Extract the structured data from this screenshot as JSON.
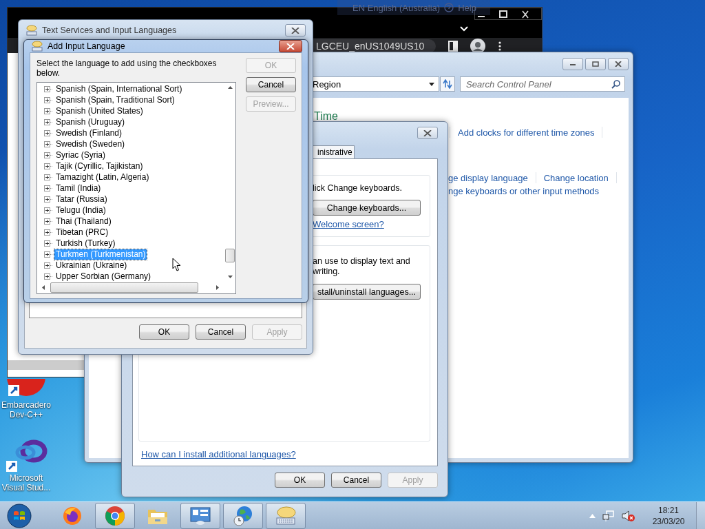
{
  "language_bar": {
    "language": "EN English (Australia)",
    "help": "Help"
  },
  "browser": {
    "address": "LGCEU_enUS1049US10"
  },
  "control_panel": {
    "address": "Region",
    "search_placeholder": "Search Control Panel",
    "heading": "Time",
    "top_link": "Add clocks for different time zones",
    "links_row": [
      "ge display language",
      "Change location"
    ],
    "link_below": "nge keyboards or other input methods"
  },
  "region_dialog": {
    "tab": "inistrative",
    "keyboards_text": "lick Change keyboards.",
    "keyboards_button": "Change keyboards...",
    "welcome_link": "Welcome screen?",
    "display_text": "an use to display text and writing.",
    "install_button": "stall/uninstall languages...",
    "help_link": "How can I install additional languages?",
    "buttons": [
      {
        "label": "OK",
        "disabled": false
      },
      {
        "label": "Cancel",
        "disabled": false
      },
      {
        "label": "Apply",
        "disabled": true
      }
    ]
  },
  "text_services": {
    "title": "Text Services and Input Languages",
    "buttons": [
      {
        "label": "OK",
        "disabled": false
      },
      {
        "label": "Cancel",
        "disabled": false
      },
      {
        "label": "Apply",
        "disabled": true
      }
    ]
  },
  "add_language": {
    "title": "Add Input Language",
    "instruction": "Select the language to add using the checkboxes below.",
    "buttons": [
      {
        "label": "OK",
        "disabled": true
      },
      {
        "label": "Cancel",
        "disabled": false
      },
      {
        "label": "Preview...",
        "disabled": true
      }
    ],
    "languages": [
      {
        "name": "Spanish (Spain, International Sort)",
        "selected": false
      },
      {
        "name": "Spanish (Spain, Traditional Sort)",
        "selected": false
      },
      {
        "name": "Spanish (United States)",
        "selected": false
      },
      {
        "name": "Spanish (Uruguay)",
        "selected": false
      },
      {
        "name": "Swedish (Finland)",
        "selected": false
      },
      {
        "name": "Swedish (Sweden)",
        "selected": false
      },
      {
        "name": "Syriac (Syria)",
        "selected": false
      },
      {
        "name": "Tajik (Cyrillic, Tajikistan)",
        "selected": false
      },
      {
        "name": "Tamazight (Latin, Algeria)",
        "selected": false
      },
      {
        "name": "Tamil (India)",
        "selected": false
      },
      {
        "name": "Tatar (Russia)",
        "selected": false
      },
      {
        "name": "Telugu (India)",
        "selected": false
      },
      {
        "name": "Thai (Thailand)",
        "selected": false
      },
      {
        "name": "Tibetan (PRC)",
        "selected": false
      },
      {
        "name": "Turkish (Turkey)",
        "selected": false
      },
      {
        "name": "Turkmen (Turkmenistan)",
        "selected": true
      },
      {
        "name": "Ukrainian (Ukraine)",
        "selected": false
      },
      {
        "name": "Upper Sorbian (Germany)",
        "selected": false
      }
    ]
  },
  "desktop_icons": [
    {
      "label": "Embarcadero Dev-C++",
      "kind": "devcpp"
    },
    {
      "label": "Microsoft Visual Stud...",
      "kind": "vs"
    }
  ],
  "taskbar": {
    "items": [
      {
        "kind": "firefox",
        "open": false
      },
      {
        "kind": "chrome",
        "open": true
      },
      {
        "kind": "explorer",
        "open": false
      },
      {
        "kind": "control-panel",
        "open": true
      },
      {
        "kind": "globe",
        "open": true
      },
      {
        "kind": "keyboard",
        "open": true
      }
    ],
    "time": "18:21",
    "date": "23/03/20"
  }
}
